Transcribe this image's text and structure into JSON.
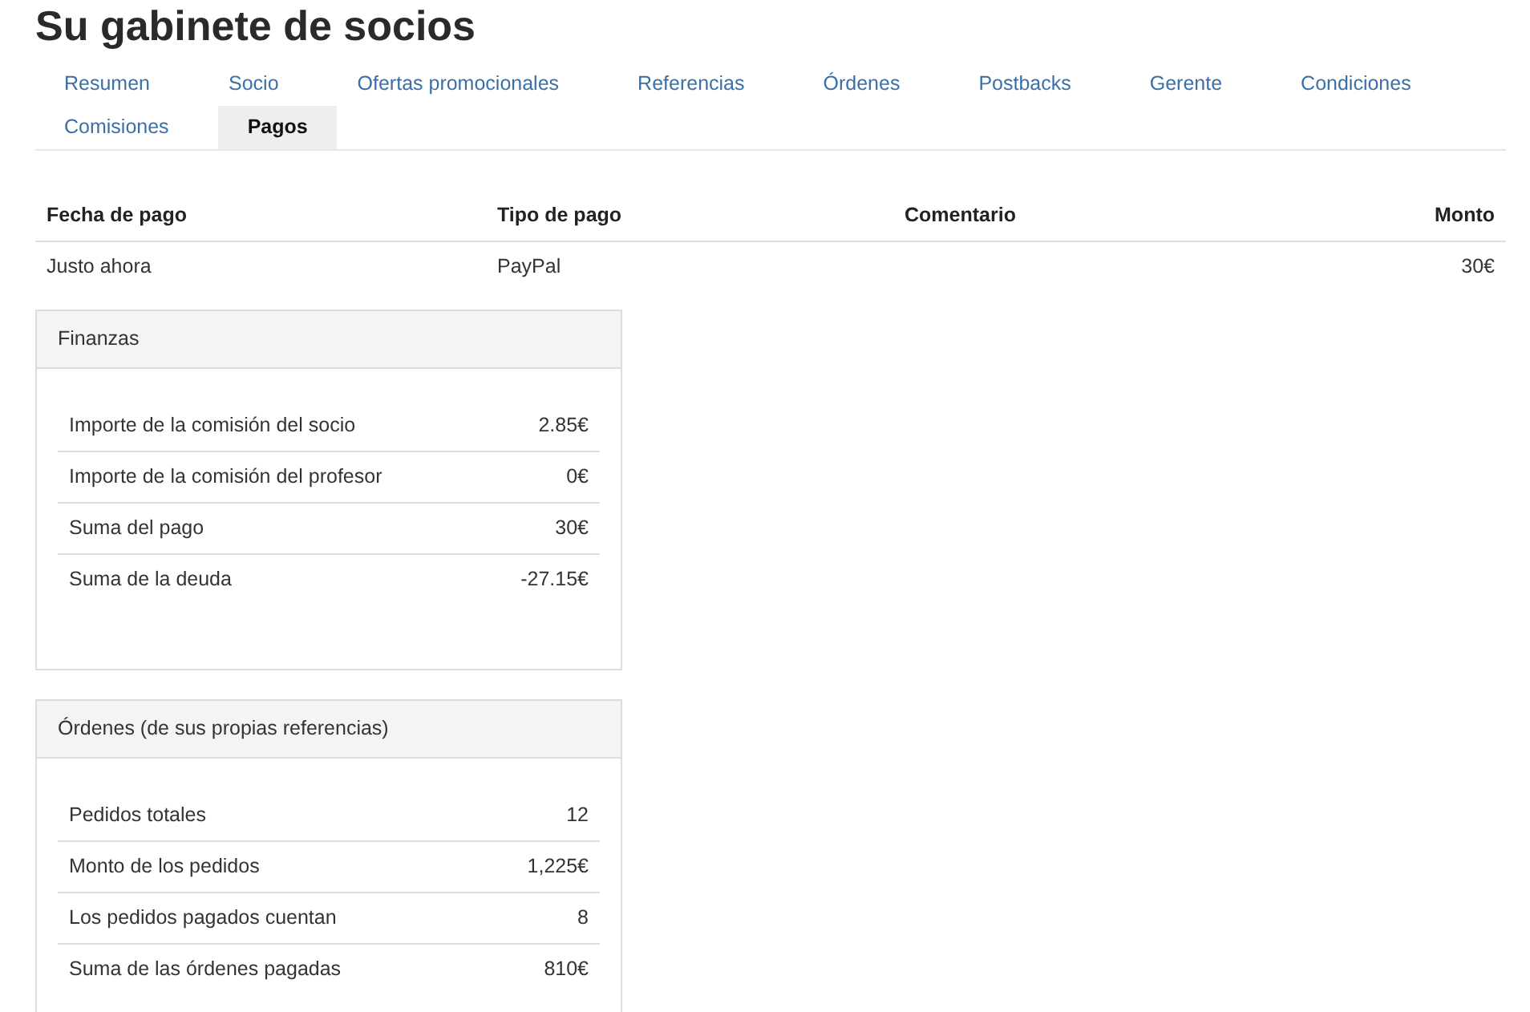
{
  "title": "Su gabinete de socios",
  "tabs": [
    {
      "label": "Resumen",
      "selected": false
    },
    {
      "label": "Socio",
      "selected": false
    },
    {
      "label": "Ofertas promocionales",
      "selected": false
    },
    {
      "label": "Referencias",
      "selected": false
    },
    {
      "label": "Órdenes",
      "selected": false
    },
    {
      "label": "Postbacks",
      "selected": false
    },
    {
      "label": "Gerente",
      "selected": false
    },
    {
      "label": "Condiciones",
      "selected": false
    },
    {
      "label": "Comisiones",
      "selected": false
    },
    {
      "label": "Pagos",
      "selected": true
    }
  ],
  "payments_table": {
    "columns": [
      "Fecha de pago",
      "Tipo de pago",
      "Comentario",
      "Monto"
    ],
    "rows": [
      [
        "Justo ahora",
        "PayPal",
        "",
        "30€"
      ]
    ]
  },
  "panels": [
    {
      "title": "Finanzas",
      "rows": [
        {
          "label": "Importe de la comisión del socio",
          "value": "2.85€"
        },
        {
          "label": "Importe de la comisión del profesor",
          "value": "0€"
        },
        {
          "label": "Suma del pago",
          "value": "30€"
        },
        {
          "label": "Suma de la deuda",
          "value": "-27.15€"
        }
      ]
    },
    {
      "title": "Órdenes (de sus propias referencias)",
      "rows": [
        {
          "label": "Pedidos totales",
          "value": "12"
        },
        {
          "label": "Monto de los pedidos",
          "value": "1,225€"
        },
        {
          "label": "Los pedidos pagados cuentan",
          "value": "8"
        },
        {
          "label": "Suma de las órdenes pagadas",
          "value": "810€"
        }
      ]
    }
  ]
}
